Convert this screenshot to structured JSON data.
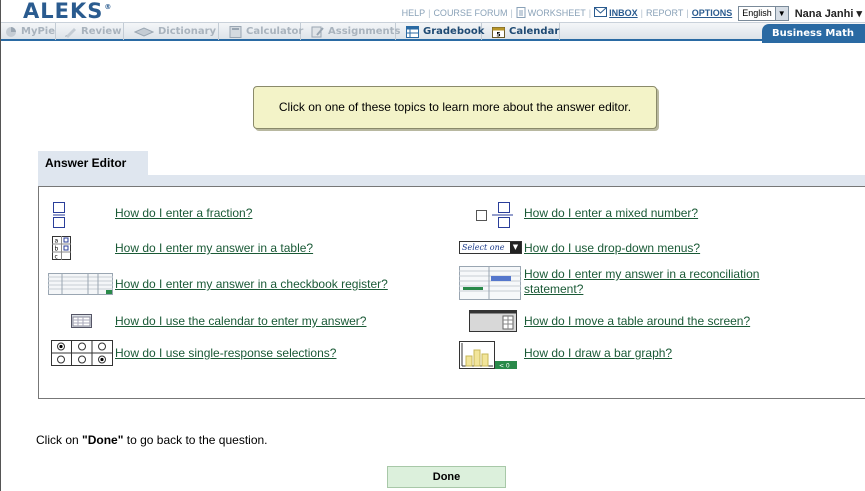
{
  "header": {
    "logo": "ALEKS",
    "logo_mark": "®",
    "links": {
      "help": "HELP",
      "course_forum": "COURSE FORUM",
      "worksheet": "WORKSHEET",
      "inbox": "INBOX",
      "report": "REPORT",
      "options": "OPTIONS"
    },
    "language": "English",
    "user_name": "Nana Janhi"
  },
  "tabs": [
    {
      "label": "MyPie",
      "icon": "pie-icon"
    },
    {
      "label": "Review",
      "icon": "pencil-icon"
    },
    {
      "label": "Dictionary",
      "icon": "book-icon"
    },
    {
      "label": "Calculator",
      "icon": "calculator-icon"
    },
    {
      "label": "Assignments",
      "icon": "assignment-icon"
    },
    {
      "label": "Gradebook",
      "icon": "gradebook-icon"
    },
    {
      "label": "Calendar",
      "icon": "calendar-icon"
    }
  ],
  "course_tab": "Business Math",
  "tooltip": "Click on one of these topics to learn more about the answer editor.",
  "answer_editor": {
    "title": "Answer Editor",
    "left_topics": [
      {
        "label": "How do I enter a fraction?",
        "icon": "fraction-icon"
      },
      {
        "label": "How do I enter my answer in a table?",
        "icon": "table-icon"
      },
      {
        "label": "How do I enter my answer in a checkbook register?",
        "icon": "checkbook-register-icon"
      },
      {
        "label": "How do I use the calendar to enter my answer?",
        "icon": "calendar-grid-icon"
      },
      {
        "label": "How do I use single-response selections?",
        "icon": "radio-buttons-icon"
      }
    ],
    "right_topics": [
      {
        "label": "How do I enter a mixed number?",
        "icon": "mixed-number-icon"
      },
      {
        "label": "How do I use drop-down menus?",
        "icon": "dropdown-icon"
      },
      {
        "label_line1": "How do I enter my answer in a reconciliation",
        "label_line2": "statement?",
        "icon": "reconciliation-icon"
      },
      {
        "label": "How do I move a table around the screen?",
        "icon": "move-table-icon"
      },
      {
        "label": "How do I draw a bar graph?",
        "icon": "bar-graph-icon"
      }
    ],
    "dropdown_sample": "Select one"
  },
  "footer": {
    "instruction_pre": "Click on ",
    "instruction_bold": "\"Done\"",
    "instruction_post": " to go back to the question.",
    "done_label": "Done"
  },
  "colors": {
    "brand": "#2a5b8f",
    "link": "#1a5a36",
    "tooltip_bg": "#f3f3c8",
    "panel_tab_bg": "#dfe6ef",
    "done_bg": "#dcf0dc"
  }
}
